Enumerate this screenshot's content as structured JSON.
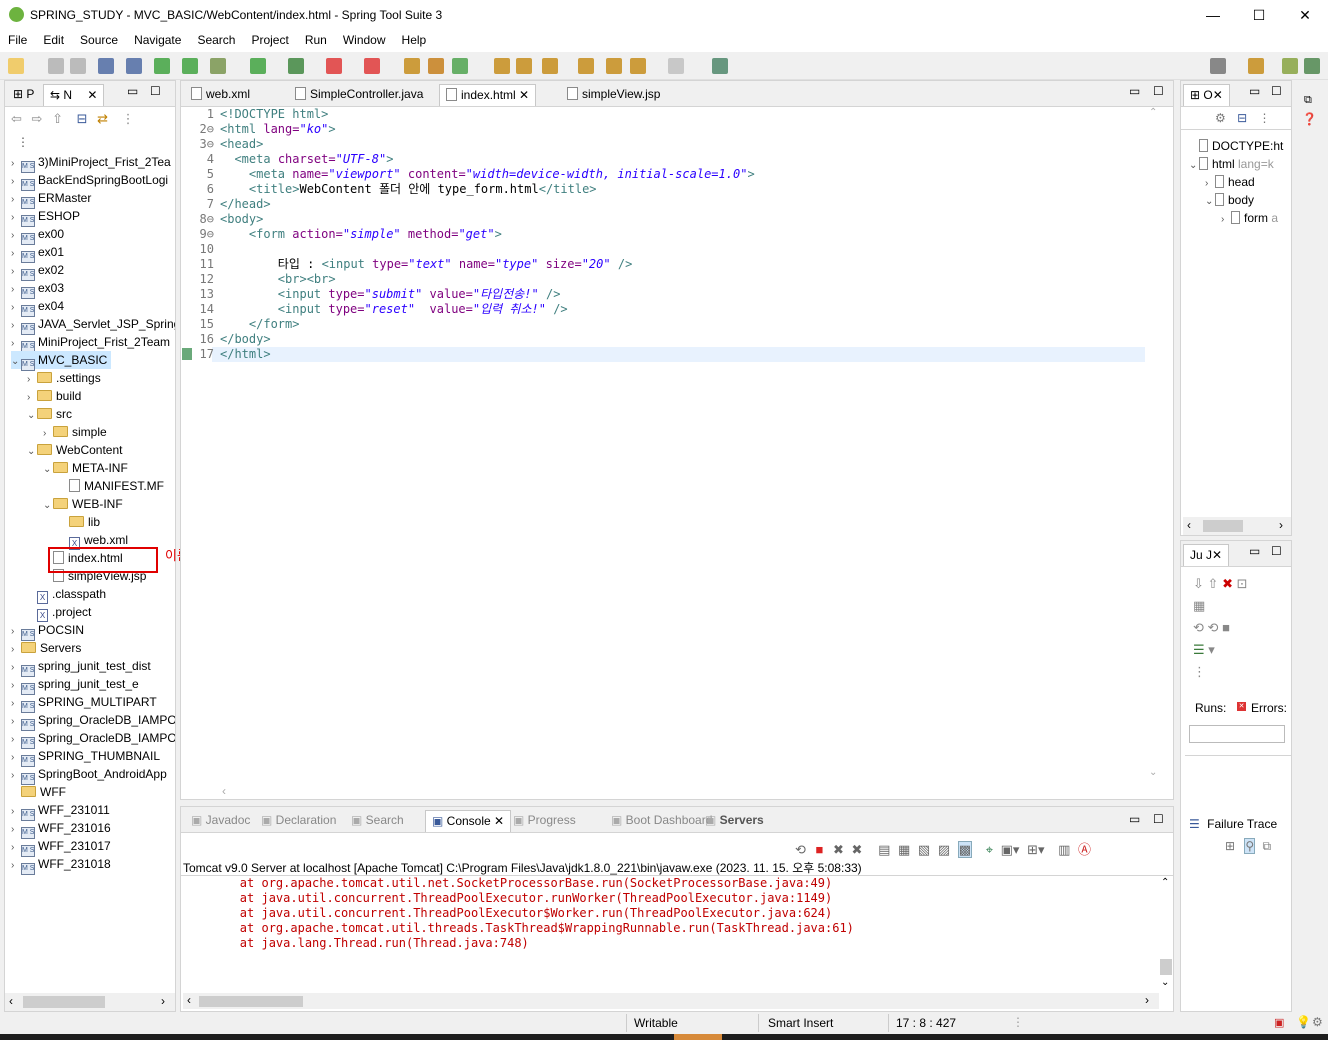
{
  "window": {
    "title": "SPRING_STUDY - MVC_BASIC/WebContent/index.html - Spring Tool Suite 3",
    "minimize": "—",
    "maximize": "☐",
    "close": "✕"
  },
  "menu": [
    "File",
    "Edit",
    "Source",
    "Navigate",
    "Search",
    "Project",
    "Run",
    "Window",
    "Help"
  ],
  "explorer": {
    "tabs": [
      "P",
      "N"
    ],
    "items": [
      {
        "label": "3)MiniProject_Frist_2Tea",
        "type": "proj",
        "depth": 0,
        "arrow": "›"
      },
      {
        "label": "BackEndSpringBootLogi",
        "type": "proj",
        "depth": 0,
        "arrow": "›"
      },
      {
        "label": "ERMaster",
        "type": "proj",
        "depth": 0,
        "arrow": "›"
      },
      {
        "label": "ESHOP",
        "type": "proj",
        "depth": 0,
        "arrow": "›"
      },
      {
        "label": "ex00",
        "type": "proj",
        "depth": 0,
        "arrow": "›"
      },
      {
        "label": "ex01",
        "type": "proj",
        "depth": 0,
        "arrow": "›"
      },
      {
        "label": "ex02",
        "type": "proj",
        "depth": 0,
        "arrow": "›"
      },
      {
        "label": "ex03",
        "type": "proj",
        "depth": 0,
        "arrow": "›"
      },
      {
        "label": "ex04",
        "type": "proj",
        "depth": 0,
        "arrow": "›"
      },
      {
        "label": "JAVA_Servlet_JSP_Spring",
        "type": "proj",
        "depth": 0,
        "arrow": "›"
      },
      {
        "label": "MiniProject_Frist_2Team",
        "type": "proj",
        "depth": 0,
        "arrow": "›"
      },
      {
        "label": "MVC_BASIC",
        "type": "proj",
        "depth": 0,
        "arrow": "⌄",
        "selected": true
      },
      {
        "label": ".settings",
        "type": "fold",
        "depth": 1,
        "arrow": "›"
      },
      {
        "label": "build",
        "type": "fold",
        "depth": 1,
        "arrow": "›"
      },
      {
        "label": "src",
        "type": "fold",
        "depth": 1,
        "arrow": "⌄"
      },
      {
        "label": "simple",
        "type": "fold",
        "depth": 2,
        "arrow": "›"
      },
      {
        "label": "WebContent",
        "type": "fold",
        "depth": 1,
        "arrow": "⌄"
      },
      {
        "label": "META-INF",
        "type": "fold",
        "depth": 2,
        "arrow": "⌄"
      },
      {
        "label": "MANIFEST.MF",
        "type": "file",
        "depth": 3,
        "arrow": ""
      },
      {
        "label": "WEB-INF",
        "type": "fold",
        "depth": 2,
        "arrow": "⌄"
      },
      {
        "label": "lib",
        "type": "fold",
        "depth": 3,
        "arrow": ""
      },
      {
        "label": "web.xml",
        "type": "x",
        "depth": 3,
        "arrow": ""
      },
      {
        "label": "index.html",
        "type": "file",
        "depth": 2,
        "arrow": "",
        "boxed": true
      },
      {
        "label": "simpleView.jsp",
        "type": "file",
        "depth": 2,
        "arrow": ""
      },
      {
        "label": ".classpath",
        "type": "x",
        "depth": 1,
        "arrow": ""
      },
      {
        "label": ".project",
        "type": "x",
        "depth": 1,
        "arrow": ""
      },
      {
        "label": "POCSIN",
        "type": "proj",
        "depth": 0,
        "arrow": "›"
      },
      {
        "label": "Servers",
        "type": "fold",
        "depth": 0,
        "arrow": "›"
      },
      {
        "label": "spring_junit_test_dist",
        "type": "proj",
        "depth": 0,
        "arrow": "›"
      },
      {
        "label": "spring_junit_test_e",
        "type": "proj",
        "depth": 0,
        "arrow": "›"
      },
      {
        "label": "SPRING_MULTIPART",
        "type": "proj",
        "depth": 0,
        "arrow": "›"
      },
      {
        "label": "Spring_OracleDB_IAMPO",
        "type": "proj",
        "depth": 0,
        "arrow": "›"
      },
      {
        "label": "Spring_OracleDB_IAMPO",
        "type": "proj",
        "depth": 0,
        "arrow": "›"
      },
      {
        "label": "SPRING_THUMBNAIL",
        "type": "proj",
        "depth": 0,
        "arrow": "›"
      },
      {
        "label": "SpringBoot_AndroidApp",
        "type": "proj",
        "depth": 0,
        "arrow": "›"
      },
      {
        "label": "WFF",
        "type": "fold",
        "depth": 0,
        "arrow": ""
      },
      {
        "label": "WFF_231011",
        "type": "proj",
        "depth": 0,
        "arrow": "›"
      },
      {
        "label": "WFF_231016",
        "type": "proj",
        "depth": 0,
        "arrow": "›"
      },
      {
        "label": "WFF_231017",
        "type": "proj",
        "depth": 0,
        "arrow": "›"
      },
      {
        "label": "WFF_231018",
        "type": "proj",
        "depth": 0,
        "arrow": "›"
      }
    ],
    "annotation": "이름 변경"
  },
  "editor": {
    "tabs": [
      {
        "label": "web.xml",
        "active": false
      },
      {
        "label": "SimpleController.java",
        "active": false
      },
      {
        "label": "index.html",
        "active": true
      },
      {
        "label": "simpleView.jsp",
        "active": false
      }
    ],
    "line_numbers": [
      "1",
      "2⊖",
      "3⊖",
      "4",
      "5",
      "6",
      "7",
      "8⊖",
      "9⊖",
      "10",
      "11",
      "12",
      "13",
      "14",
      "15",
      "16",
      "17"
    ],
    "lines": [
      [
        [
          "dt",
          "<!DOCTYPE html>"
        ]
      ],
      [
        [
          "tg",
          "<html "
        ],
        [
          "at",
          "lang="
        ],
        [
          "av",
          "\"ko\""
        ],
        [
          "tg",
          ">"
        ]
      ],
      [
        [
          "tg",
          "<head>"
        ]
      ],
      [
        [
          "tx",
          "  "
        ],
        [
          "tg",
          "<meta "
        ],
        [
          "at",
          "charset="
        ],
        [
          "av",
          "\"UTF-8\""
        ],
        [
          "tg",
          ">"
        ]
      ],
      [
        [
          "tx",
          "    "
        ],
        [
          "tg",
          "<meta "
        ],
        [
          "at",
          "name="
        ],
        [
          "av",
          "\"viewport\""
        ],
        [
          "tx",
          " "
        ],
        [
          "at",
          "content="
        ],
        [
          "av",
          "\"width=device-width, initial-scale=1.0\""
        ],
        [
          "tg",
          ">"
        ]
      ],
      [
        [
          "tx",
          "    "
        ],
        [
          "tg",
          "<title>"
        ],
        [
          "tx",
          "WebContent 폴더 안에 type_form.html"
        ],
        [
          "tg",
          "</title>"
        ]
      ],
      [
        [
          "tg",
          "</head>"
        ]
      ],
      [
        [
          "tg",
          "<body>"
        ]
      ],
      [
        [
          "tx",
          "    "
        ],
        [
          "tg",
          "<form "
        ],
        [
          "at",
          "action="
        ],
        [
          "av",
          "\"simple\""
        ],
        [
          "tx",
          " "
        ],
        [
          "at",
          "method="
        ],
        [
          "av",
          "\"get\""
        ],
        [
          "tg",
          ">"
        ]
      ],
      [
        [
          "tx",
          ""
        ]
      ],
      [
        [
          "tx",
          "        타입 : "
        ],
        [
          "tg",
          "<input "
        ],
        [
          "at",
          "type="
        ],
        [
          "av",
          "\"text\""
        ],
        [
          "tx",
          " "
        ],
        [
          "at",
          "name="
        ],
        [
          "av",
          "\"type\""
        ],
        [
          "tx",
          " "
        ],
        [
          "at",
          "size="
        ],
        [
          "av",
          "\"20\""
        ],
        [
          "tx",
          " "
        ],
        [
          "tg",
          "/>"
        ]
      ],
      [
        [
          "tx",
          "        "
        ],
        [
          "tg",
          "<br><br>"
        ]
      ],
      [
        [
          "tx",
          "        "
        ],
        [
          "tg",
          "<input "
        ],
        [
          "at",
          "type="
        ],
        [
          "av",
          "\"submit\""
        ],
        [
          "tx",
          " "
        ],
        [
          "at",
          "value="
        ],
        [
          "av",
          "\"타입전송!\""
        ],
        [
          "tx",
          " "
        ],
        [
          "tg",
          "/>"
        ]
      ],
      [
        [
          "tx",
          "        "
        ],
        [
          "tg",
          "<input "
        ],
        [
          "at",
          "type="
        ],
        [
          "av",
          "\"reset\""
        ],
        [
          "tx",
          "  "
        ],
        [
          "at",
          "value="
        ],
        [
          "av",
          "\"입력 취소!\""
        ],
        [
          "tx",
          " "
        ],
        [
          "tg",
          "/>"
        ]
      ],
      [
        [
          "tx",
          "    "
        ],
        [
          "tg",
          "</form>"
        ]
      ],
      [
        [
          "tg",
          "</body>"
        ]
      ],
      [
        [
          "tg",
          "</html>"
        ]
      ]
    ]
  },
  "outline": {
    "tab": "O",
    "items": [
      {
        "label": "DOCTYPE:ht",
        "depth": 0,
        "arrow": ""
      },
      {
        "label": "html",
        "extra": " lang=k",
        "depth": 0,
        "arrow": "⌄"
      },
      {
        "label": "head",
        "depth": 1,
        "arrow": "›"
      },
      {
        "label": "body",
        "depth": 1,
        "arrow": "⌄"
      },
      {
        "label": "form",
        "extra": " a",
        "depth": 2,
        "arrow": "›"
      }
    ]
  },
  "junit": {
    "tab": "J",
    "runs": "Runs:",
    "errors": "Errors:",
    "failure_trace": "Failure Trace"
  },
  "console": {
    "tabs": [
      "Javadoc",
      "Declaration",
      "Search",
      "Console",
      "Progress",
      "Boot Dashboard",
      "Servers"
    ],
    "active_tab": "Console",
    "header": "Tomcat v9.0 Server at localhost [Apache Tomcat] C:\\Program Files\\Java\\jdk1.8.0_221\\bin\\javaw.exe  (2023. 11. 15. 오후 5:08:33)",
    "lines": [
      "        at org.apache.tomcat.util.net.SocketProcessorBase.run(SocketProcessorBase.java:49)",
      "        at java.util.concurrent.ThreadPoolExecutor.runWorker(ThreadPoolExecutor.java:1149)",
      "        at java.util.concurrent.ThreadPoolExecutor$Worker.run(ThreadPoolExecutor.java:624)",
      "        at org.apache.tomcat.util.threads.TaskThread$WrappingRunnable.run(TaskThread.java:61)",
      "        at java.lang.Thread.run(Thread.java:748)"
    ]
  },
  "status": {
    "writable": "Writable",
    "insert": "Smart Insert",
    "position": "17 : 8 : 427"
  },
  "colors": {
    "accent": "#3399ff",
    "error_red": "#c00000",
    "box_red": "#e00000"
  }
}
